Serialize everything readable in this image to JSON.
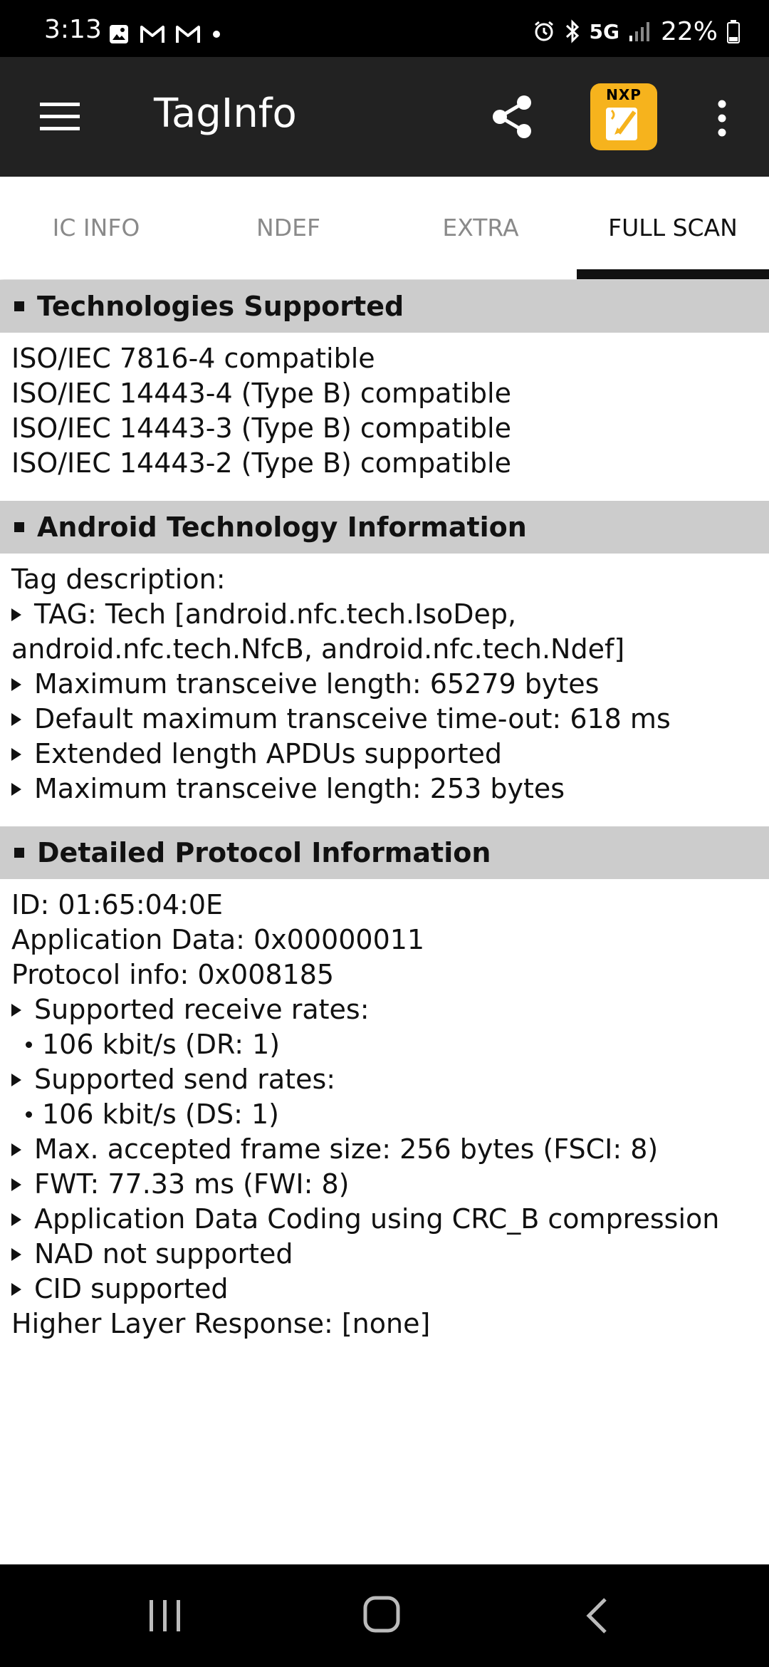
{
  "status_bar": {
    "time": "3:13",
    "network": "5G",
    "battery": "22%"
  },
  "app_bar": {
    "title": "TagInfo",
    "logo_text": "NXP"
  },
  "tabs": [
    {
      "label": "IC INFO",
      "active": false
    },
    {
      "label": "NDEF",
      "active": false
    },
    {
      "label": "EXTRA",
      "active": false
    },
    {
      "label": "FULL SCAN",
      "active": true
    }
  ],
  "sections": {
    "technologies": {
      "title": "Technologies Supported",
      "lines": [
        "ISO/IEC 7816-4 compatible",
        "ISO/IEC 14443-4 (Type B) compatible",
        "ISO/IEC 14443-3 (Type B) compatible",
        "ISO/IEC 14443-2 (Type B) compatible"
      ]
    },
    "android": {
      "title": "Android Technology Information",
      "lines": [
        "Tag description:",
        "TAG: Tech [android.nfc.tech.IsoDep,",
        "android.nfc.tech.NfcB, android.nfc.tech.Ndef]",
        "Maximum transceive length: 65279 bytes",
        "Default maximum transceive time-out: 618 ms",
        "Extended length APDUs supported",
        "Maximum transceive length: 253 bytes"
      ]
    },
    "protocol": {
      "title": "Detailed Protocol Information",
      "lines": [
        "ID: 01:65:04:0E",
        "Application Data: 0x00000011",
        "Protocol info: 0x008185",
        "Supported receive rates:",
        "106 kbit/s (DR: 1)",
        "Supported send rates:",
        "106 kbit/s (DS: 1)",
        "Max. accepted frame size: 256 bytes (FSCI: 8)",
        "FWT: 77.33 ms  (FWI: 8)",
        "Application Data Coding using CRC_B compression",
        "NAD not supported",
        "CID supported",
        "Higher Layer Response: [none]"
      ]
    }
  }
}
